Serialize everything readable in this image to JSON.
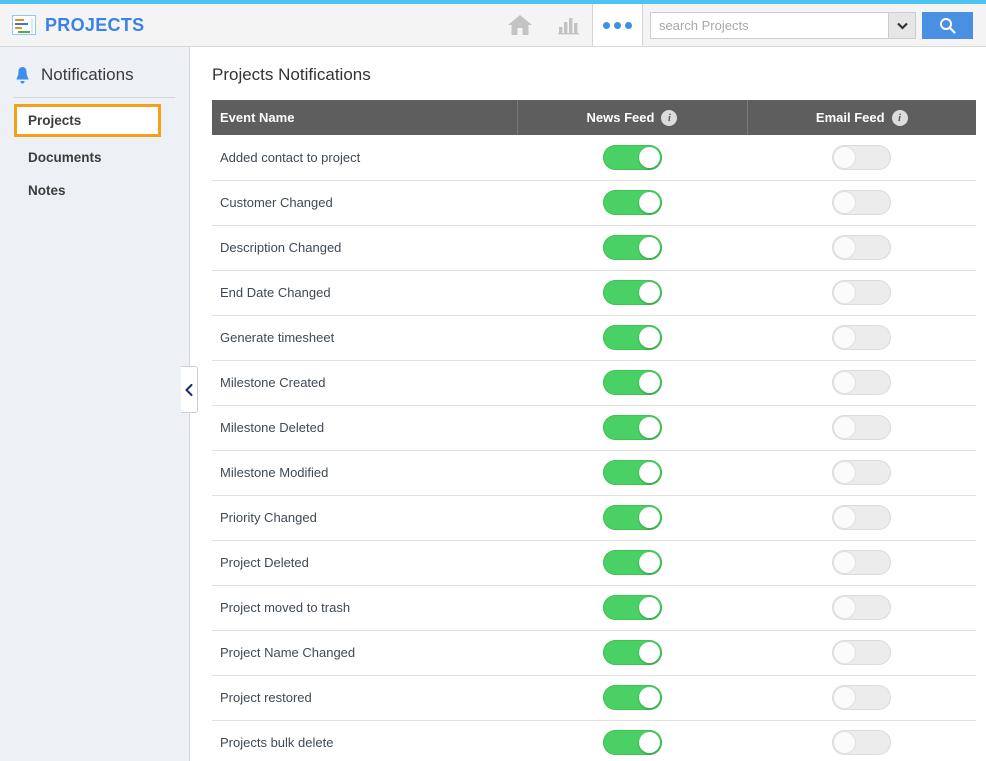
{
  "header": {
    "brand_title": "PROJECTS",
    "brand_logo_icon": "gantt-chart-logo-icon",
    "home_icon": "home-icon",
    "reports_icon": "bar-chart-icon",
    "more_icon": "more-dots-icon",
    "search_placeholder": "search Projects",
    "search_value": "",
    "search_scope_icon": "chevron-down-icon",
    "search_button_icon": "search-icon",
    "accent_color": "#4cc3f0",
    "brand_color": "#3b82e8",
    "search_button_color": "#4a90e2"
  },
  "sidebar": {
    "bell_icon": "bell-icon",
    "title": "Notifications",
    "items": [
      {
        "label": "Projects",
        "selected": true
      },
      {
        "label": "Documents",
        "selected": false
      },
      {
        "label": "Notes",
        "selected": false
      }
    ],
    "selected_outline_color": "#f6a01a",
    "collapse_handle_icon": "chevron-left-icon",
    "background_color": "#edf1f5"
  },
  "main": {
    "page_title": "Projects Notifications",
    "table": {
      "header_background": "#5e5e5e",
      "columns": [
        {
          "label": "Event Name",
          "info": false
        },
        {
          "label": "News Feed",
          "info": true,
          "info_icon": "info-icon"
        },
        {
          "label": "Email Feed",
          "info": true,
          "info_icon": "info-icon"
        }
      ],
      "toggle_on_color": "#4ad165",
      "toggle_off_color": "#ececec",
      "rows": [
        {
          "event": "Added contact to project",
          "news_feed": true,
          "email_feed": false
        },
        {
          "event": "Customer Changed",
          "news_feed": true,
          "email_feed": false
        },
        {
          "event": "Description Changed",
          "news_feed": true,
          "email_feed": false
        },
        {
          "event": "End Date Changed",
          "news_feed": true,
          "email_feed": false
        },
        {
          "event": "Generate timesheet",
          "news_feed": true,
          "email_feed": false
        },
        {
          "event": "Milestone Created",
          "news_feed": true,
          "email_feed": false
        },
        {
          "event": "Milestone Deleted",
          "news_feed": true,
          "email_feed": false
        },
        {
          "event": "Milestone Modified",
          "news_feed": true,
          "email_feed": false
        },
        {
          "event": "Priority Changed",
          "news_feed": true,
          "email_feed": false
        },
        {
          "event": "Project Deleted",
          "news_feed": true,
          "email_feed": false
        },
        {
          "event": "Project moved to trash",
          "news_feed": true,
          "email_feed": false
        },
        {
          "event": "Project Name Changed",
          "news_feed": true,
          "email_feed": false
        },
        {
          "event": "Project restored",
          "news_feed": true,
          "email_feed": false
        },
        {
          "event": "Projects bulk delete",
          "news_feed": true,
          "email_feed": false
        }
      ]
    }
  }
}
